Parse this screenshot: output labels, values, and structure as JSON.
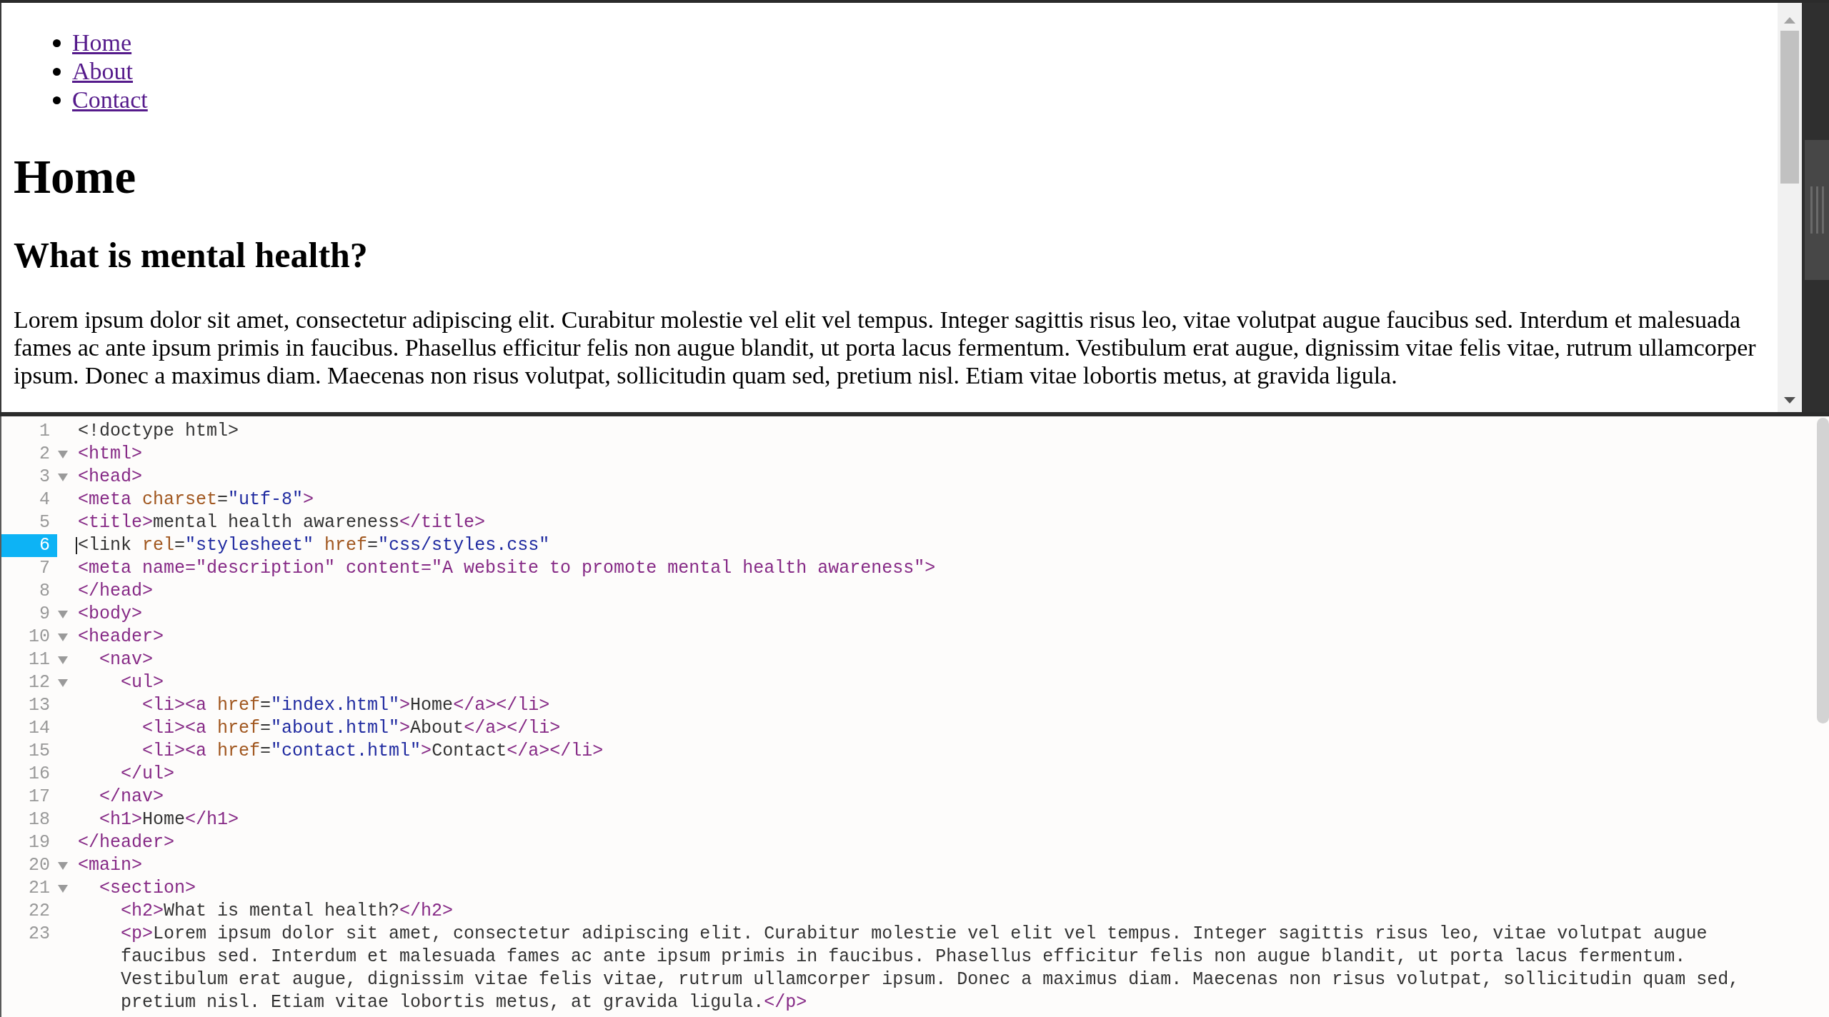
{
  "preview": {
    "nav_links": [
      {
        "label": "Home",
        "visited": true
      },
      {
        "label": "About",
        "visited": true
      },
      {
        "label": "Contact",
        "visited": true
      }
    ],
    "heading": "Home",
    "section_heading": "What is mental health?",
    "paragraph": "Lorem ipsum dolor sit amet, consectetur adipiscing elit. Curabitur molestie vel elit vel tempus. Integer sagittis risus leo, vitae volutpat augue faucibus sed. Interdum et malesuada fames ac ante ipsum primis in faucibus. Phasellus efficitur felis non augue blandit, ut porta lacus fermentum. Vestibulum erat augue, dignissim vitae felis vitae, rutrum ullamcorper ipsum. Donec a maximus diam. Maecenas non risus volutpat, sollicitudin quam sed, pretium nisl. Etiam vitae lobortis metus, at gravida ligula."
  },
  "editor": {
    "lines": [
      {
        "number": "1",
        "foldable": false,
        "current": false,
        "tokens": [
          {
            "kind": "text",
            "text": "<!doctype html>"
          }
        ]
      },
      {
        "number": "2",
        "foldable": true,
        "current": false,
        "tokens": [
          {
            "kind": "tag",
            "text": "<html>"
          }
        ]
      },
      {
        "number": "3",
        "foldable": true,
        "current": false,
        "tokens": [
          {
            "kind": "tag",
            "text": "<head>"
          }
        ]
      },
      {
        "number": "4",
        "foldable": false,
        "current": false,
        "tokens": [
          {
            "kind": "tag",
            "text": "<meta"
          },
          {
            "kind": "attr",
            "text": " charset"
          },
          {
            "kind": "text",
            "text": "="
          },
          {
            "kind": "value",
            "text": "\"utf-8\""
          },
          {
            "kind": "tag",
            "text": ">"
          }
        ]
      },
      {
        "number": "5",
        "foldable": false,
        "current": false,
        "tokens": [
          {
            "kind": "tag",
            "text": "<title>"
          },
          {
            "kind": "text",
            "text": "mental health awareness"
          },
          {
            "kind": "tag",
            "text": "</title>"
          }
        ]
      },
      {
        "number": "6",
        "foldable": false,
        "current": true,
        "tokens": [
          {
            "kind": "text",
            "text": "<link "
          },
          {
            "kind": "attr",
            "text": "rel"
          },
          {
            "kind": "text",
            "text": "="
          },
          {
            "kind": "value",
            "text": "\"stylesheet\""
          },
          {
            "kind": "attr",
            "text": " href"
          },
          {
            "kind": "text",
            "text": "="
          },
          {
            "kind": "value",
            "text": "\"css/styles.css\""
          }
        ]
      },
      {
        "number": "7",
        "foldable": false,
        "current": false,
        "tokens": [
          {
            "kind": "tag",
            "text": "<meta name=\"description\" content=\"A website to promote mental health awareness\">"
          }
        ]
      },
      {
        "number": "8",
        "foldable": false,
        "current": false,
        "tokens": [
          {
            "kind": "tag",
            "text": "</head>"
          }
        ]
      },
      {
        "number": "9",
        "foldable": true,
        "current": false,
        "tokens": [
          {
            "kind": "tag",
            "text": "<body>"
          }
        ]
      },
      {
        "number": "10",
        "foldable": true,
        "current": false,
        "tokens": [
          {
            "kind": "tag",
            "text": "<header>"
          }
        ]
      },
      {
        "number": "11",
        "foldable": true,
        "current": false,
        "tokens": [
          {
            "kind": "tag",
            "text": "  <nav>"
          }
        ]
      },
      {
        "number": "12",
        "foldable": true,
        "current": false,
        "tokens": [
          {
            "kind": "tag",
            "text": "    <ul>"
          }
        ]
      },
      {
        "number": "13",
        "foldable": false,
        "current": false,
        "tokens": [
          {
            "kind": "tag",
            "text": "      <li><a"
          },
          {
            "kind": "attr",
            "text": " href"
          },
          {
            "kind": "text",
            "text": "="
          },
          {
            "kind": "value",
            "text": "\"index.html\""
          },
          {
            "kind": "tag",
            "text": ">"
          },
          {
            "kind": "text",
            "text": "Home"
          },
          {
            "kind": "tag",
            "text": "</a></li>"
          }
        ]
      },
      {
        "number": "14",
        "foldable": false,
        "current": false,
        "tokens": [
          {
            "kind": "tag",
            "text": "      <li><a"
          },
          {
            "kind": "attr",
            "text": " href"
          },
          {
            "kind": "text",
            "text": "="
          },
          {
            "kind": "value",
            "text": "\"about.html\""
          },
          {
            "kind": "tag",
            "text": ">"
          },
          {
            "kind": "text",
            "text": "About"
          },
          {
            "kind": "tag",
            "text": "</a></li>"
          }
        ]
      },
      {
        "number": "15",
        "foldable": false,
        "current": false,
        "tokens": [
          {
            "kind": "tag",
            "text": "      <li><a"
          },
          {
            "kind": "attr",
            "text": " href"
          },
          {
            "kind": "text",
            "text": "="
          },
          {
            "kind": "value",
            "text": "\"contact.html\""
          },
          {
            "kind": "tag",
            "text": ">"
          },
          {
            "kind": "text",
            "text": "Contact"
          },
          {
            "kind": "tag",
            "text": "</a></li>"
          }
        ]
      },
      {
        "number": "16",
        "foldable": false,
        "current": false,
        "tokens": [
          {
            "kind": "tag",
            "text": "    </ul>"
          }
        ]
      },
      {
        "number": "17",
        "foldable": false,
        "current": false,
        "tokens": [
          {
            "kind": "tag",
            "text": "  </nav>"
          }
        ]
      },
      {
        "number": "18",
        "foldable": false,
        "current": false,
        "tokens": [
          {
            "kind": "tag",
            "text": "  <h1>"
          },
          {
            "kind": "text",
            "text": "Home"
          },
          {
            "kind": "tag",
            "text": "</h1>"
          }
        ]
      },
      {
        "number": "19",
        "foldable": false,
        "current": false,
        "tokens": [
          {
            "kind": "tag",
            "text": "</header>"
          }
        ]
      },
      {
        "number": "20",
        "foldable": true,
        "current": false,
        "tokens": [
          {
            "kind": "tag",
            "text": "<main>"
          }
        ]
      },
      {
        "number": "21",
        "foldable": true,
        "current": false,
        "tokens": [
          {
            "kind": "tag",
            "text": "  <section>"
          }
        ]
      },
      {
        "number": "22",
        "foldable": false,
        "current": false,
        "tokens": [
          {
            "kind": "tag",
            "text": "    <h2>"
          },
          {
            "kind": "text",
            "text": "What is mental health?"
          },
          {
            "kind": "tag",
            "text": "</h2>"
          }
        ]
      },
      {
        "number": "23",
        "foldable": false,
        "current": false,
        "tokens": [
          {
            "kind": "tag",
            "text": "    <p>"
          },
          {
            "kind": "text",
            "text": "Lorem ipsum dolor sit amet, consectetur adipiscing elit. Curabitur molestie vel elit vel tempus. Integer sagittis risus leo, vitae volutpat augue faucibus sed. Interdum et malesuada fames ac ante ipsum primis in faucibus. Phasellus efficitur felis non augue blandit, ut porta lacus fermentum. Vestibulum erat augue, dignissim vitae felis vitae, rutrum ullamcorper ipsum. Donec a maximus diam. Maecenas non risus volutpat, sollicitudin quam sed, pretium nisl. Etiam vitae lobortis metus, at gravida ligula."
          },
          {
            "kind": "tag",
            "text": "</p>"
          }
        ]
      }
    ]
  }
}
